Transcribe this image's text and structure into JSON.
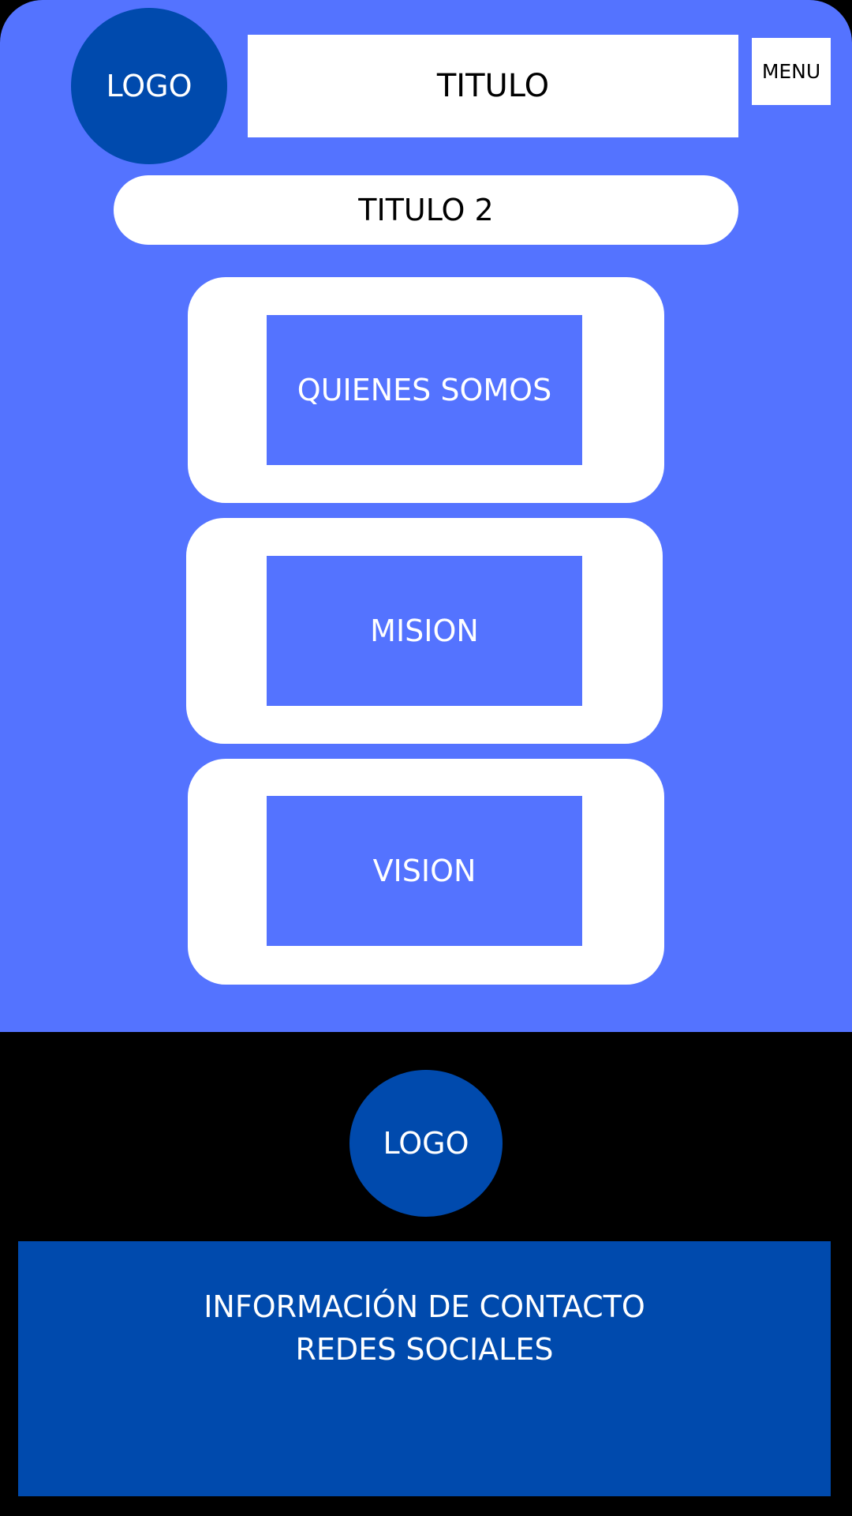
{
  "header": {
    "logo_label": "LOGO",
    "title": "TITULO",
    "menu_label": "MENU",
    "subtitle": "TITULO 2"
  },
  "sections": [
    {
      "label": "QUIENES SOMOS"
    },
    {
      "label": "MISION"
    },
    {
      "label": "VISION"
    }
  ],
  "footer": {
    "logo_label": "LOGO",
    "contact_info": "INFORMACIÓN DE CONTACTO",
    "social_media": "REDES SOCIALES"
  },
  "colors": {
    "primary_bg": "#5473ff",
    "logo_bg": "#004aad",
    "footer_bg": "#000000",
    "card_bg": "#ffffff"
  }
}
